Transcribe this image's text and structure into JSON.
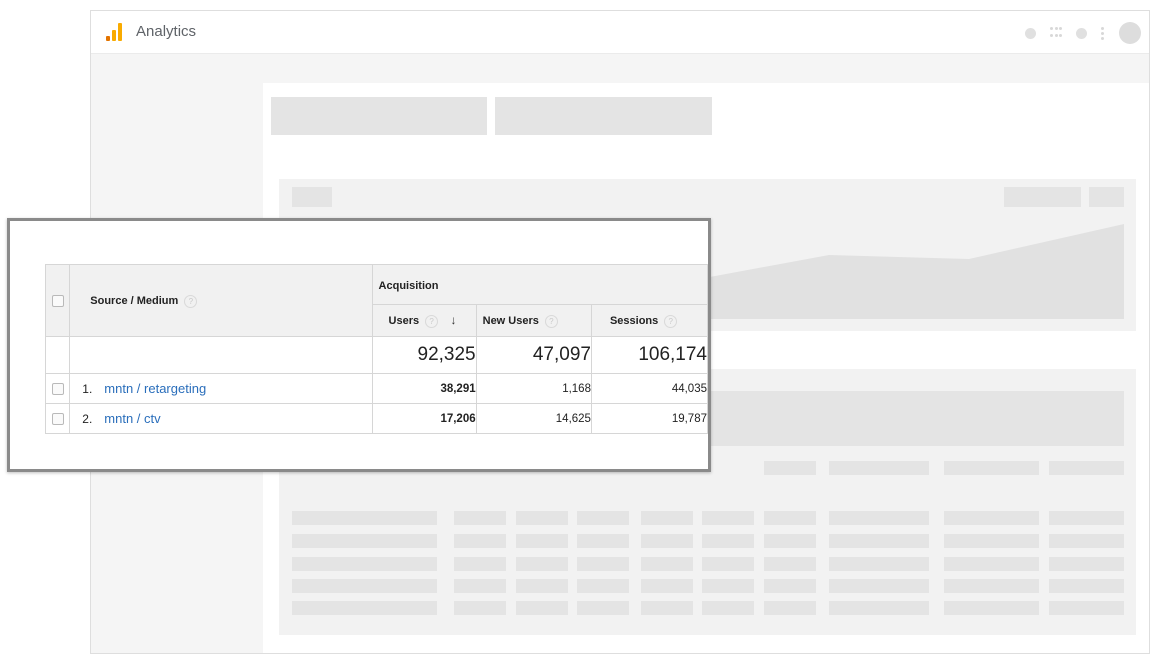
{
  "app": {
    "title": "Analytics",
    "brand_colors": [
      "#f9ab00",
      "#e37400"
    ]
  },
  "header_icons": [
    "status-dot-icon",
    "apps-grid-icon",
    "notification-dot-icon",
    "more-vert-icon",
    "account-avatar"
  ],
  "table": {
    "dimension_header": "Source / Medium",
    "group_header": "Acquisition",
    "columns": [
      "Users",
      "New Users",
      "Sessions"
    ],
    "sort_indicator": "↓",
    "help_symbol": "?",
    "totals": {
      "users": "92,325",
      "new_users": "47,097",
      "sessions": "106,174"
    },
    "rows": [
      {
        "rank": "1.",
        "source": "mntn / retargeting",
        "users": "38,291",
        "new_users": "1,168",
        "sessions": "44,035"
      },
      {
        "rank": "2.",
        "source": "mntn / ctv",
        "users": "17,206",
        "new_users": "14,625",
        "sessions": "19,787"
      }
    ]
  }
}
